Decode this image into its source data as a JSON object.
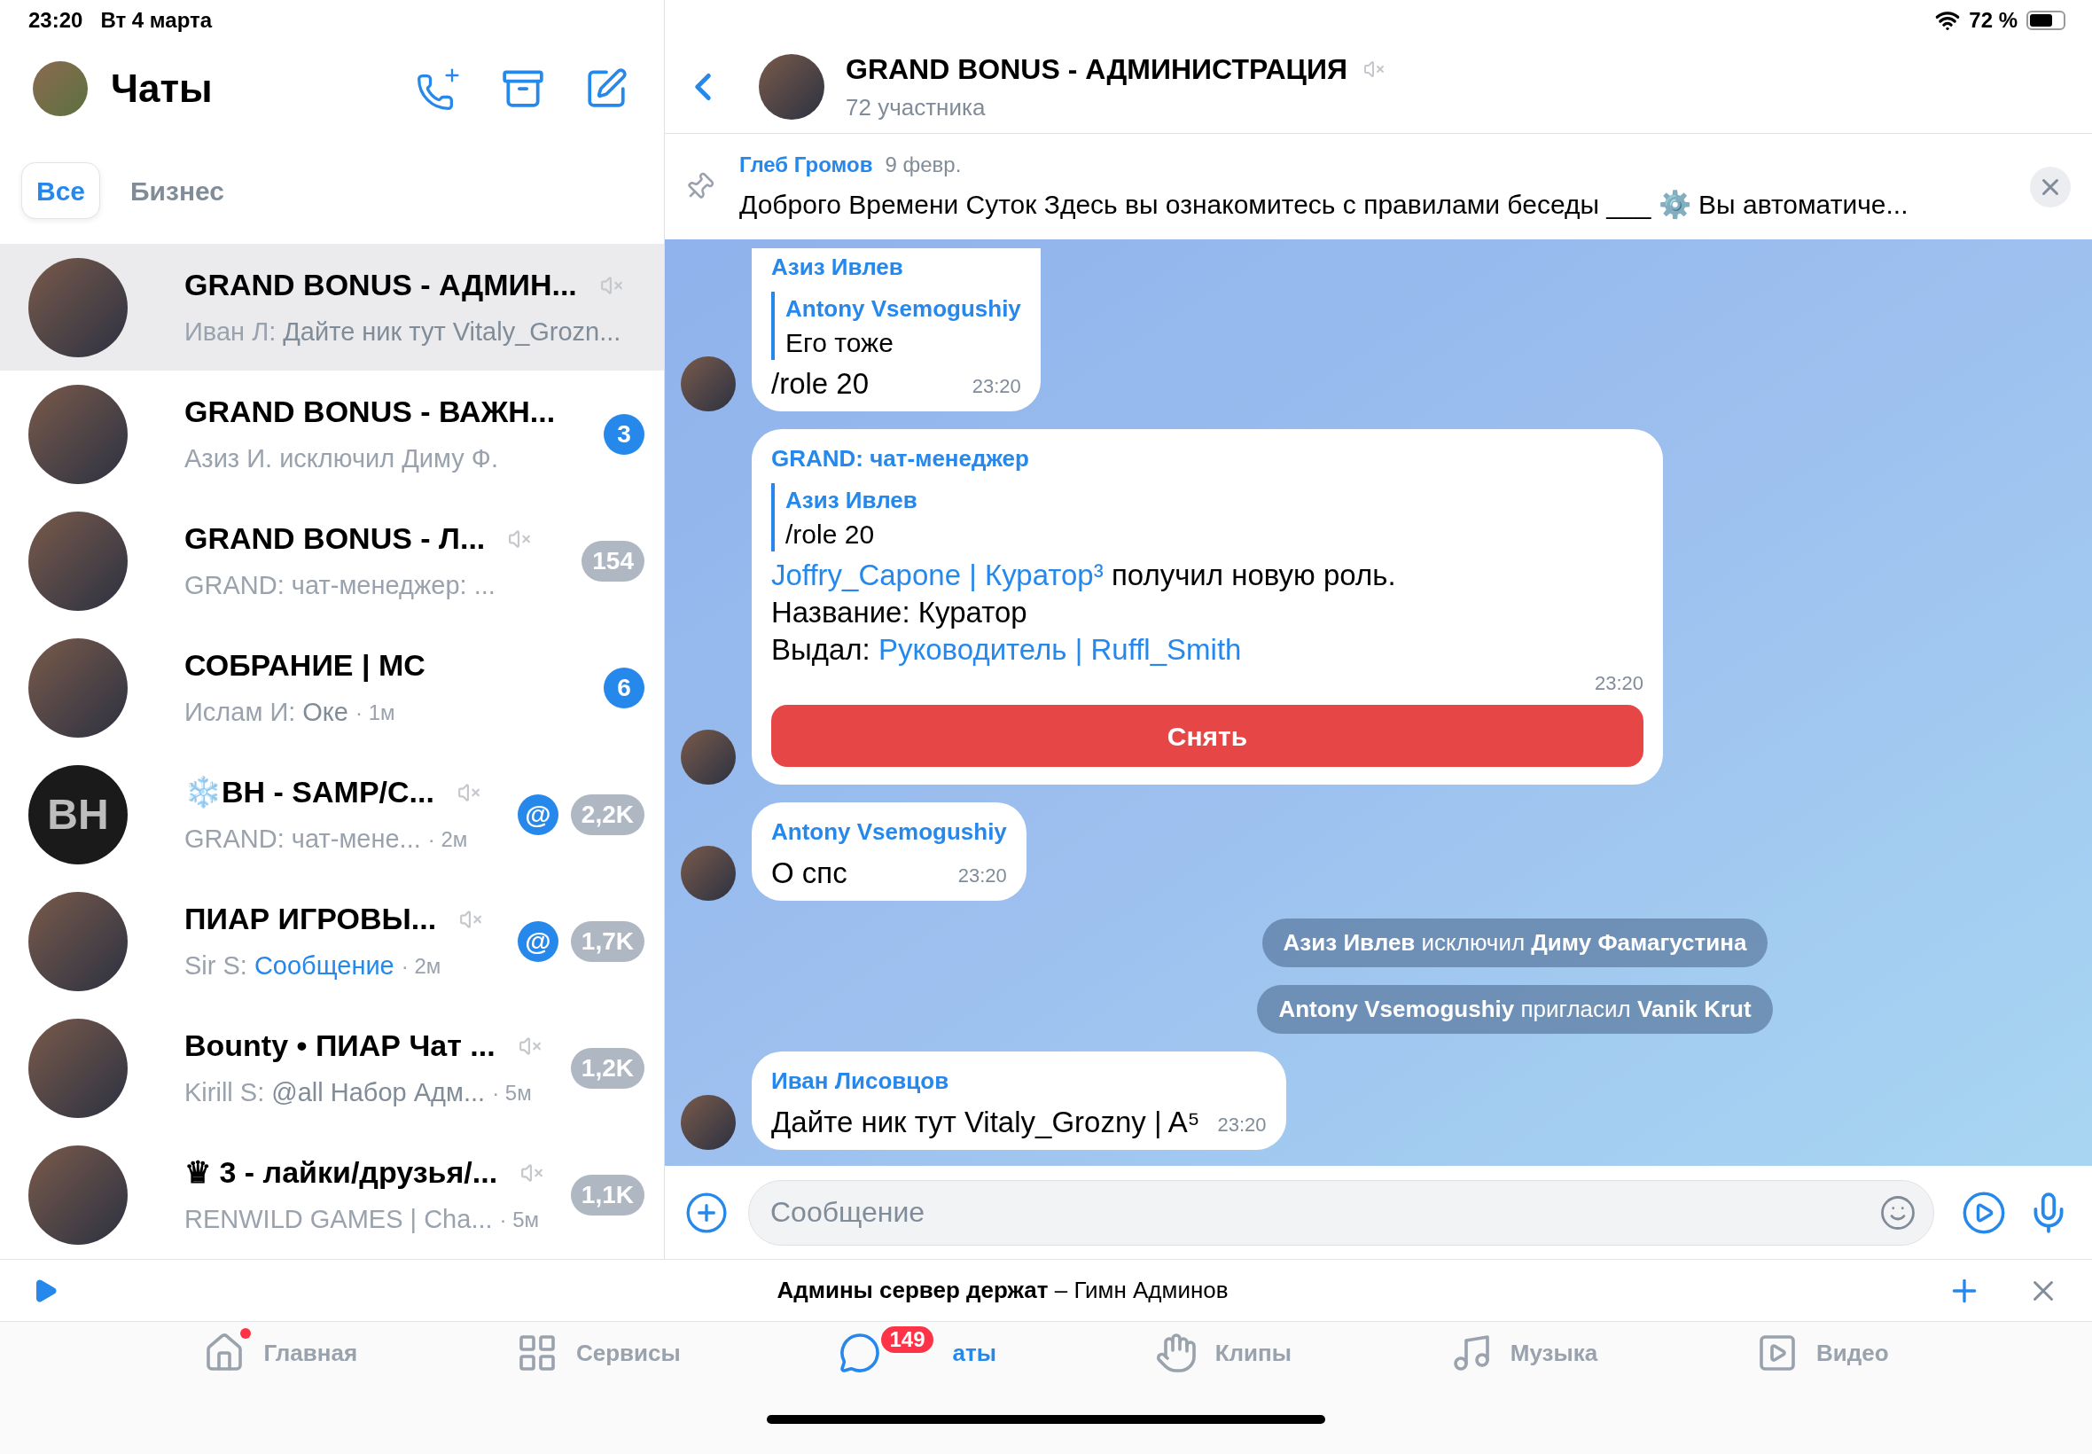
{
  "status_bar": {
    "time": "23:20",
    "date": "Вт 4 марта",
    "battery": "72 %"
  },
  "sidebar": {
    "title": "Чаты",
    "filters": [
      {
        "label": "Все",
        "selected": true
      },
      {
        "label": "Бизнес",
        "selected": false
      }
    ],
    "chats": [
      {
        "title": "GRAND BONUS - АДМИН...",
        "muted": true,
        "selected": true,
        "avatar": {
          "kind": "photo"
        },
        "sender": "Иван Л:",
        "preview": "Дайте ник тут Vitaly_Grozn...",
        "link": false
      },
      {
        "title": "GRAND BONUS - ВАЖН...",
        "muted": false,
        "selected": false,
        "avatar": {
          "kind": "photo"
        },
        "preview": "Азиз И. исключил Диму Ф.",
        "link": false,
        "unread": "3"
      },
      {
        "title": "GRAND BONUS - Л...",
        "muted": true,
        "selected": false,
        "avatar": {
          "kind": "photo"
        },
        "preview": "GRAND: чат-менеджер: ...",
        "link": false,
        "unread": "154"
      },
      {
        "title": "СОБРАНИЕ | МС",
        "muted": false,
        "selected": false,
        "avatar": {
          "kind": "photo"
        },
        "sender": "Ислам И:",
        "preview": "Оке",
        "link": false,
        "time": "· 1м",
        "unread": "6"
      },
      {
        "title": "❄️BH - SAMP/C...",
        "muted": true,
        "selected": false,
        "avatar": {
          "kind": "text",
          "text": "BH"
        },
        "preview": "GRAND: чат-мене...",
        "link": false,
        "time": "· 2м",
        "mention": "@",
        "unread": "2,2K"
      },
      {
        "title": "ПИАР ИГРОВЫ...",
        "muted": true,
        "selected": false,
        "avatar": {
          "kind": "photo"
        },
        "sender": "Sir S:",
        "preview": "Сообщение",
        "link": true,
        "time": "· 2м",
        "mention": "@",
        "unread": "1,7K"
      },
      {
        "title": "Bounty • ПИАР Чат ...",
        "muted": true,
        "selected": false,
        "avatar": {
          "kind": "photo"
        },
        "sender": "Kirill S:",
        "preview": "@all Набор Адм...",
        "link": false,
        "time": "· 5м",
        "unread": "1,2K"
      },
      {
        "title": "♛ 3 - лайки/друзья/...",
        "muted": true,
        "selected": false,
        "avatar": {
          "kind": "photo"
        },
        "preview": "RENWILD GAMES | Cha...",
        "link": false,
        "time": "· 5м",
        "unread": "1,1K"
      }
    ]
  },
  "chat": {
    "title": "GRAND BONUS - АДМИНИСТРАЦИЯ",
    "muted": true,
    "subtitle": "72 участника",
    "pinned": {
      "author": "Глеб Громов",
      "date": "9 февр.",
      "text": "Доброго Времени Суток Здесь вы ознакомитесь с правилами беседы ___ ⚙️ Вы автоматиче..."
    },
    "messages": [
      {
        "kind": "bubble",
        "sender": "Азиз Ивлев",
        "reply": {
          "author": "Antony Vsemogushiy",
          "text": "Его тоже"
        },
        "lines": [
          [
            {
              "text": "/role 20",
              "link": false
            }
          ]
        ],
        "time": "23:20"
      },
      {
        "kind": "bubble",
        "sender": "GRAND: чат-менеджер",
        "reply": {
          "author": "Азиз Ивлев",
          "text": "/role 20"
        },
        "lines": [
          [
            {
              "text": "Joffry_Capone | Куратор³",
              "link": true
            },
            {
              "text": " получил новую роль.",
              "link": false
            }
          ],
          [
            {
              "text": "Название: Куратор",
              "link": false
            }
          ],
          [
            {
              "text": "Выдал: ",
              "link": false
            },
            {
              "text": "Руководитель | Ruffl_Smith",
              "link": true
            }
          ]
        ],
        "time": "23:20",
        "button": "Снять"
      },
      {
        "kind": "bubble",
        "sender": "Antony Vsemogushiy",
        "lines": [
          [
            {
              "text": "О спс",
              "link": false
            }
          ]
        ],
        "time": "23:20"
      },
      {
        "kind": "service",
        "text": "**Азиз Ивлев** исключил **Диму Фамагустина**"
      },
      {
        "kind": "service",
        "text": "**Antony Vsemogushiy** пригласил **Vanik Krut**"
      },
      {
        "kind": "bubble",
        "sender": "Иван Лисовцов",
        "lines": [
          [
            {
              "text": "Дайте ник тут Vitaly_Grozny | A⁵",
              "link": false
            }
          ]
        ],
        "time": "23:20"
      }
    ],
    "composer": {
      "placeholder": "Сообщение"
    }
  },
  "player": {
    "text": "**Админы сервер держат** – Гимн Админов"
  },
  "tabbar": [
    {
      "kind": "home",
      "label": "Главная",
      "selected": false,
      "dot": true
    },
    {
      "kind": "services",
      "label": "Сервисы",
      "selected": false,
      "dot": false
    },
    {
      "kind": "chats",
      "label": "аты",
      "selected": true,
      "dot": false,
      "badge": "149"
    },
    {
      "kind": "clips",
      "label": "Клипы",
      "selected": false,
      "dot": false
    },
    {
      "kind": "music",
      "label": "Музыка",
      "selected": false,
      "dot": false
    },
    {
      "kind": "video",
      "label": "Видео",
      "selected": false,
      "dot": false
    }
  ]
}
